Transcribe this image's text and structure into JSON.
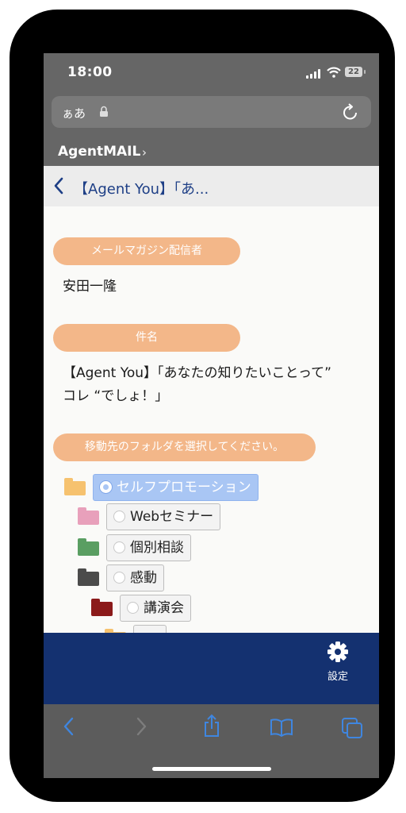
{
  "status": {
    "time": "18:00",
    "battery": "22"
  },
  "browser": {
    "url_text": "ぁあ"
  },
  "app": {
    "title": "AgentMAIL",
    "chevron": "›"
  },
  "nav": {
    "title": "【Agent You】「あ..."
  },
  "sender": {
    "label": "メールマガジン配信者",
    "value": "安田一隆"
  },
  "subject": {
    "label": "件名",
    "line1": "【Agent You】「あなたの知りたいことって”",
    "line2": "コレ “でしょ！」"
  },
  "folder_select": {
    "label": "移動先のフォルダを選択してください。",
    "folders": [
      {
        "name": "セルフプロモーション",
        "color": "#f6c26f",
        "selected": true
      },
      {
        "name": "Webセミナー",
        "color": "#e8a0bb",
        "selected": false
      },
      {
        "name": "個別相談",
        "color": "#5a9e62",
        "selected": false
      },
      {
        "name": "感動",
        "color": "#4b4b4b",
        "selected": false
      },
      {
        "name": "講演会",
        "color": "#8b1a1a",
        "selected": false
      }
    ]
  },
  "bottom_bar": {
    "settings_label": "設定"
  },
  "colors": {
    "accent": "#143170",
    "pill": "#f3b789",
    "nav_text": "#1e3f86",
    "selected": "#a9c6f4"
  }
}
